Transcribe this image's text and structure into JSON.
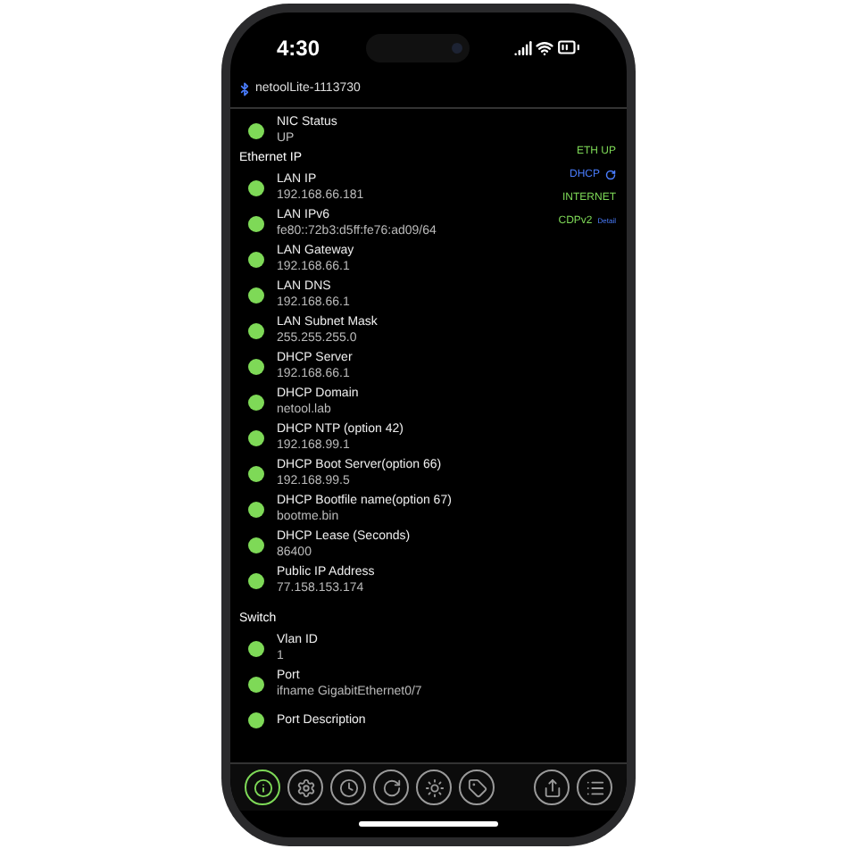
{
  "status_bar": {
    "time": "4:30"
  },
  "header": {
    "title": "netoolLite-1113730"
  },
  "indicators": [
    {
      "label": "ETH UP",
      "color": "#7ed957",
      "kind": "plain"
    },
    {
      "label": "DHCP",
      "color": "#4a7dff",
      "kind": "refresh"
    },
    {
      "label": "INTERNET",
      "color": "#7ed957",
      "kind": "plain"
    },
    {
      "label": "CDPv2",
      "color": "#7ed957",
      "kind": "detail",
      "detail": "Detail"
    }
  ],
  "sections": [
    {
      "items": [
        {
          "label": "NIC Status",
          "value": "UP",
          "on": true
        }
      ]
    },
    {
      "title": "Ethernet IP",
      "items": [
        {
          "label": "LAN IP",
          "value": "192.168.66.181",
          "on": true
        },
        {
          "label": "LAN IPv6",
          "value": "fe80::72b3:d5ff:fe76:ad09/64",
          "on": true
        },
        {
          "label": "LAN Gateway",
          "value": "192.168.66.1",
          "on": true
        },
        {
          "label": "LAN DNS",
          "value": "192.168.66.1",
          "on": true
        },
        {
          "label": "LAN Subnet Mask",
          "value": "255.255.255.0",
          "on": true
        },
        {
          "label": "DHCP Server",
          "value": "192.168.66.1",
          "on": true
        },
        {
          "label": "DHCP Domain",
          "value": "netool.lab",
          "on": true
        },
        {
          "label": "DHCP NTP (option 42)",
          "value": "192.168.99.1",
          "on": true
        },
        {
          "label": "DHCP Boot Server(option 66)",
          "value": "192.168.99.5",
          "on": true
        },
        {
          "label": "DHCP Bootfile name(option 67)",
          "value": "bootme.bin",
          "on": true
        },
        {
          "label": "DHCP Lease (Seconds)",
          "value": "86400",
          "on": true
        },
        {
          "label": "Public IP Address",
          "value": "77.158.153.174",
          "on": true
        }
      ]
    },
    {
      "title": "Switch",
      "items": [
        {
          "label": "Vlan ID",
          "value": "1",
          "on": true
        },
        {
          "label": "Port",
          "value": "ifname GigabitEthernet0/7",
          "on": true
        },
        {
          "label": "Port Description",
          "on": true
        }
      ]
    }
  ],
  "toolbar": [
    {
      "kind": "info",
      "selected": true
    },
    {
      "kind": "settings",
      "selected": false
    },
    {
      "kind": "clock",
      "selected": false
    },
    {
      "kind": "refresh",
      "selected": false
    },
    {
      "kind": "sun",
      "selected": false
    },
    {
      "kind": "tag",
      "selected": false
    }
  ],
  "toolbar_right": [
    {
      "kind": "share"
    },
    {
      "kind": "list"
    }
  ]
}
